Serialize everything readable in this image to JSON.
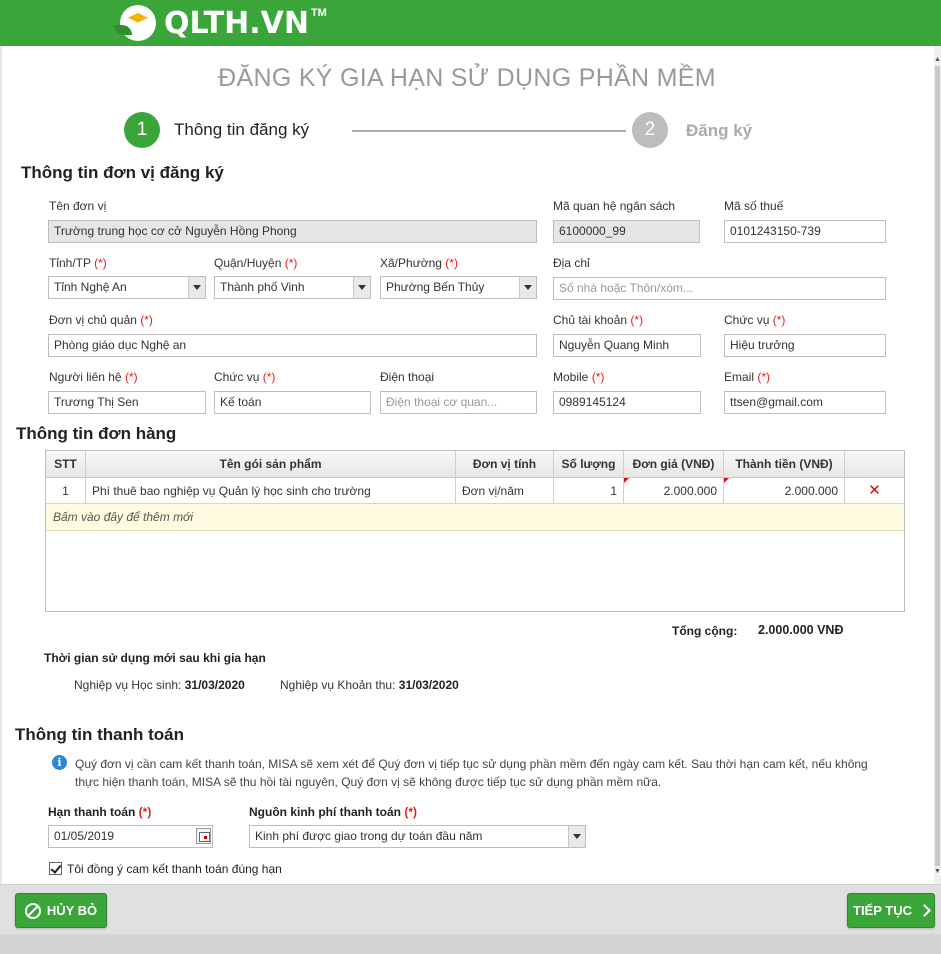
{
  "brand": {
    "name": "QLTH.VN",
    "tm": "TM"
  },
  "page": {
    "title": "ĐĂNG KÝ GIA HẠN SỬ DỤNG PHẦN MỀM"
  },
  "steps": [
    {
      "num": "1",
      "label": "Thông tin đăng ký",
      "active": true
    },
    {
      "num": "2",
      "label": "Đăng ký",
      "active": false
    }
  ],
  "unit": {
    "section_title": "Thông tin đơn vị đăng ký",
    "required_mark": "(*)",
    "name_label": "Tên đơn vị",
    "name_value": "Trường trung học cơ cở Nguyễn Hồng Phong",
    "budget_code_label": "Mã quan hệ ngân sách",
    "budget_code_value": "6100000_99",
    "tax_code_label": "Mã số thuế",
    "tax_code_value": "0101243150-739",
    "province_label": "Tỉnh/TP",
    "province_value": "Tỉnh Nghệ An",
    "district_label": "Quận/Huyện",
    "district_value": "Thành phố Vinh",
    "ward_label": "Xã/Phường",
    "ward_value": "Phường Bến Thủy",
    "address_label": "Địa chỉ",
    "address_placeholder": "Số nhà hoặc Thôn/xóm...",
    "parent_label": "Đơn vị chủ quản",
    "parent_value": "Phòng giáo dục Nghệ an",
    "account_owner_label": "Chủ tài khoản",
    "account_owner_value": "Nguyễn Quang Minh",
    "owner_position_label": "Chức vụ",
    "owner_position_value": "Hiệu trưởng",
    "contact_label": "Người liên hệ",
    "contact_value": "Trương Thị Sen",
    "contact_position_label": "Chức vụ",
    "contact_position_value": "Kế toán",
    "phone_label": "Điện thoại",
    "phone_placeholder": "Điện thoại cơ quan...",
    "mobile_label": "Mobile",
    "mobile_value": "0989145124",
    "email_label": "Email",
    "email_value": "ttsen@gmail.com"
  },
  "order": {
    "section_title": "Thông tin đơn hàng",
    "columns": [
      "STT",
      "Tên gói sản phẩm",
      "Đơn vị tính",
      "Số lượng",
      "Đơn giá (VNĐ)",
      "Thành tiền (VNĐ)"
    ],
    "rows": [
      {
        "stt": "1",
        "product": "Phí thuê bao nghiệp vụ Quản lý học sinh cho trường",
        "unit": "Đơn vị/năm",
        "qty": "1",
        "price": "2.000.000",
        "amount": "2.000.000"
      }
    ],
    "add_new_text": "Bấm vào đây để thêm mới",
    "total_label": "Tổng cộng:",
    "total_value": "2.000.000 VNĐ"
  },
  "usage": {
    "title": "Thời gian sử dụng mới sau khi gia hạn",
    "student_label": "Nghiệp vụ Học sinh:",
    "student_date": "31/03/2020",
    "fee_label": "Nghiệp vụ Khoản thu:",
    "fee_date": "31/03/2020"
  },
  "payment": {
    "section_title": "Thông tin thanh toán",
    "info_text": "Quý đơn vị cần cam kết thanh toán, MISA sẽ xem xét để Quý đơn vị tiếp tục sử dụng phần mềm đến ngày cam kết. Sau thời hạn cam kết, nếu không thực hiện thanh toán, MISA sẽ thu hồi tài nguyên, Quý đơn vị sẽ không được tiếp tục sử dụng phần mềm nữa.",
    "deadline_label": "Hạn thanh toán",
    "deadline_value": "01/05/2019",
    "source_label": "Nguồn kinh phí thanh toán",
    "source_value": "Kinh phí được giao trong dự toán đầu năm",
    "agree_label": "Tôi đồng ý cam kết thanh toán đúng hạn",
    "agree_checked": true
  },
  "footer": {
    "cancel_label": "HỦY BỎ",
    "next_label": "TIẾP TỤC"
  },
  "colors": {
    "brand_green": "#3aa63a",
    "required_red": "#e02020",
    "inactive_gray": "#bdbdbd"
  }
}
